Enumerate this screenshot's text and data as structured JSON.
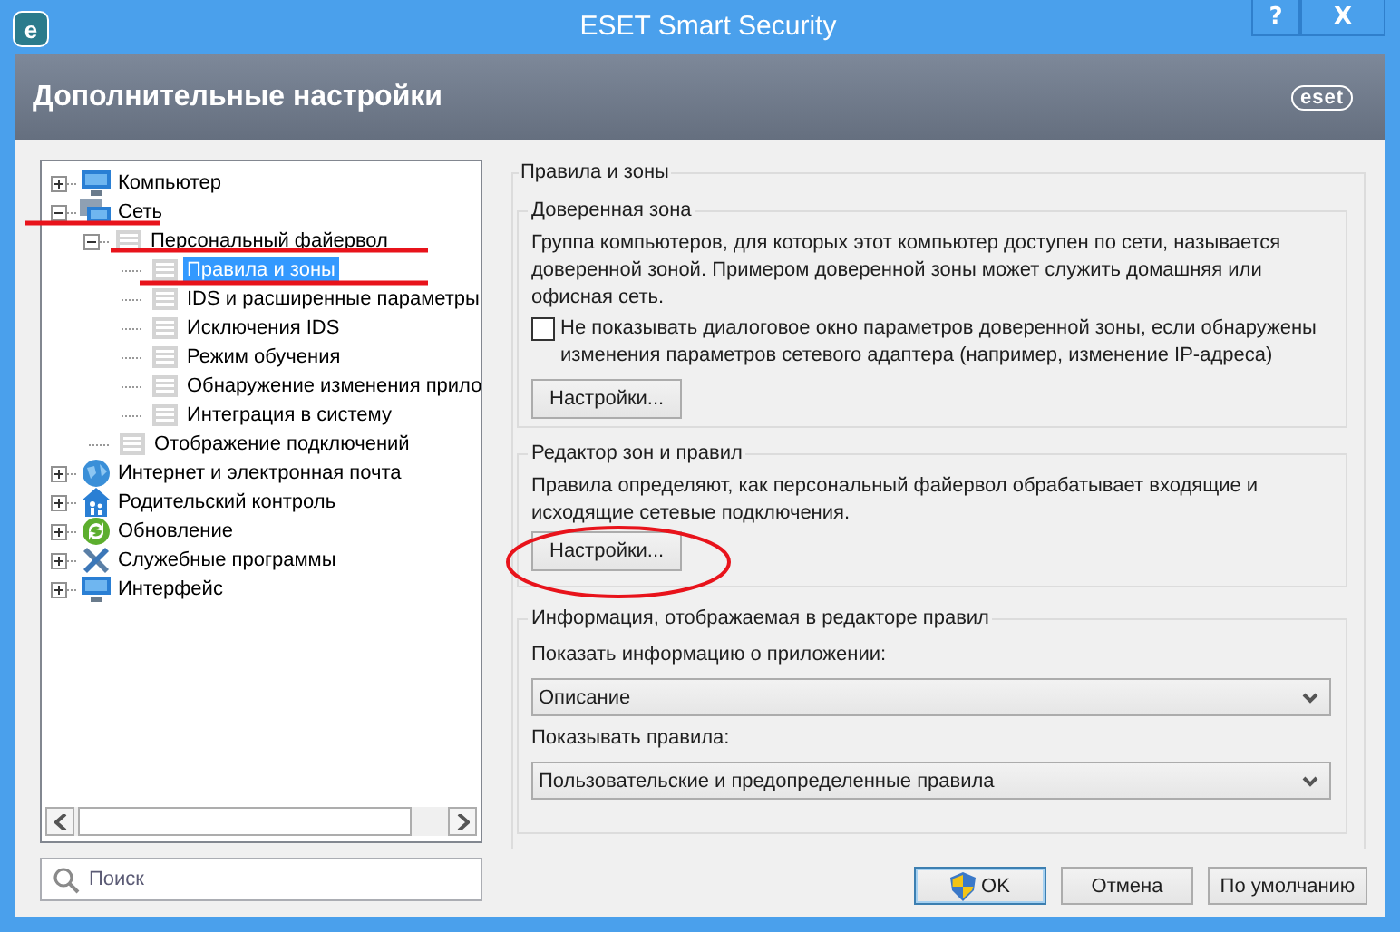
{
  "window": {
    "app_icon": "e",
    "title": "ESET Smart Security",
    "help_button": "?",
    "close_button": "X"
  },
  "header": {
    "title": "Дополнительные настройки",
    "logo": "eset"
  },
  "tree": [
    {
      "label": "Компьютер",
      "kind": "monitor",
      "expanded": false,
      "selected": false
    },
    {
      "label": "Сеть",
      "kind": "network",
      "expanded": true,
      "selected": false,
      "children": [
        {
          "label": "Персональный файервол",
          "kind": "page",
          "expanded": true,
          "selected": false,
          "children": [
            {
              "label": "Правила и зоны",
              "kind": "page",
              "selected": true
            },
            {
              "label": "IDS и расширенные параметры",
              "kind": "page",
              "selected": false
            },
            {
              "label": "Исключения IDS",
              "kind": "page",
              "selected": false
            },
            {
              "label": "Режим обучения",
              "kind": "page",
              "selected": false
            },
            {
              "label": "Обнаружение изменения прило",
              "kind": "page",
              "selected": false
            },
            {
              "label": "Интеграция в систему",
              "kind": "page",
              "selected": false
            }
          ]
        },
        {
          "label": "Отображение подключений",
          "kind": "page",
          "selected": false
        }
      ]
    },
    {
      "label": "Интернет и электронная почта",
      "kind": "globe",
      "expanded": false,
      "selected": false
    },
    {
      "label": "Родительский контроль",
      "kind": "parental",
      "expanded": false,
      "selected": false
    },
    {
      "label": "Обновление",
      "kind": "update",
      "expanded": false,
      "selected": false
    },
    {
      "label": "Служебные программы",
      "kind": "tools",
      "expanded": false,
      "selected": false
    },
    {
      "label": "Интерфейс",
      "kind": "monitor",
      "expanded": false,
      "selected": false
    }
  ],
  "search": {
    "placeholder": "Поиск"
  },
  "panel": {
    "title": "Правила и зоны",
    "groups": [
      {
        "title": "Доверенная зона",
        "text": "Группа компьютеров, для которых этот компьютер доступен по сети, называется доверенной зоной. Примером доверенной зоны может служить домашняя или офисная сеть.",
        "checkbox": {
          "label": "Не показывать диалоговое окно параметров доверенной зоны, если обнаружены изменения параметров сетевого адаптера (например, изменение IP-адреса)",
          "checked": false
        },
        "button": "Настройки..."
      },
      {
        "title": "Редактор зон и правил",
        "text": "Правила определяют, как персональный файервол обрабатывает входящие и исходящие сетевые подключения.",
        "button": "Настройки..."
      },
      {
        "title": "Информация, отображаемая в редакторе правил",
        "fields": [
          {
            "label": "Показать информацию о приложении:",
            "value": "Описание"
          },
          {
            "label": "Показывать правила:",
            "value": "Пользовательские и предопределенные правила"
          }
        ]
      }
    ]
  },
  "buttons": [
    {
      "label": "OK",
      "default": true,
      "shield": true
    },
    {
      "label": "Отмена",
      "default": false,
      "shield": false
    },
    {
      "label": "По умолчанию",
      "default": false,
      "shield": false
    }
  ]
}
